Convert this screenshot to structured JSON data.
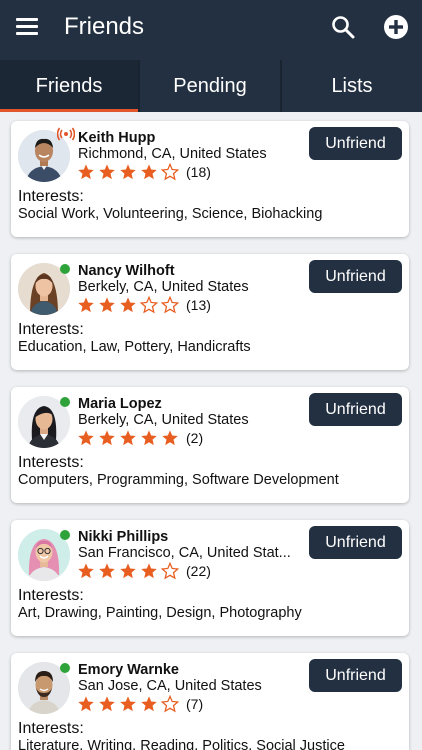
{
  "header": {
    "title": "Friends",
    "icons": {
      "menu": "menu-icon",
      "search": "search-icon",
      "add": "add-circle-icon"
    }
  },
  "tabs": [
    {
      "label": "Friends",
      "active": true
    },
    {
      "label": "Pending",
      "active": false
    },
    {
      "label": "Lists",
      "active": false
    }
  ],
  "colors": {
    "header_bg": "#233041",
    "accent": "#e1572b",
    "star": "#e85d20",
    "online": "#2ea339",
    "button_bg": "#233041"
  },
  "labels": {
    "unfriend": "Unfriend",
    "interests": "Interests:"
  },
  "friends": [
    {
      "name": "Keith Hupp",
      "location": "Richmond, CA, United States",
      "rating": 4,
      "reviews": "(18)",
      "interests": "Social Work, Volunteering, Science, Biohacking",
      "status": "broadcasting"
    },
    {
      "name": "Nancy Wilhoft",
      "location": "Berkely, CA, United States",
      "rating": 3,
      "reviews": "(13)",
      "interests": "Education, Law, Pottery, Handicrafts",
      "status": "online"
    },
    {
      "name": "Maria Lopez",
      "location": "Berkely, CA, United States",
      "rating": 5,
      "reviews": "(2)",
      "interests": "Computers, Programming, Software Development",
      "status": "online"
    },
    {
      "name": "Nikki Phillips",
      "location": "San Francisco, CA, United Stat...",
      "rating": 4,
      "reviews": "(22)",
      "interests": "Art, Drawing, Painting, Design, Photography",
      "status": "online"
    },
    {
      "name": "Emory Warnke",
      "location": "San Jose, CA, United States",
      "rating": 4,
      "reviews": "(7)",
      "interests": "Literature, Writing, Reading, Politics, Social Justice",
      "status": "online"
    }
  ]
}
